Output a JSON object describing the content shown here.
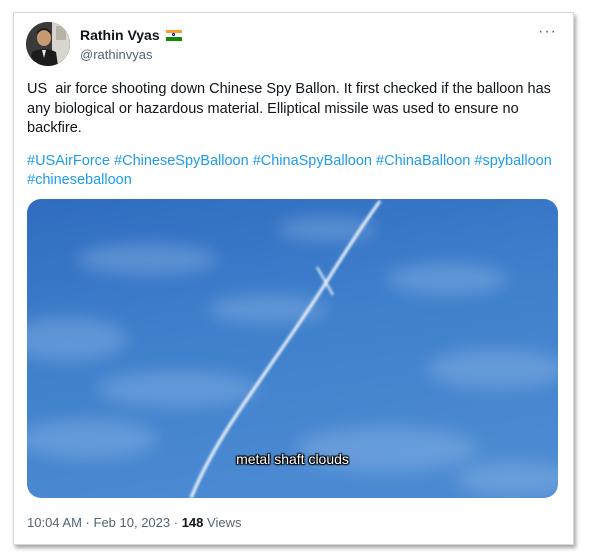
{
  "author": {
    "display_name": "Rathin Vyas",
    "handle": "@rathinvyas",
    "badge": "india-flag-icon"
  },
  "more_menu": {
    "icon": "more-horizontal-icon",
    "label": "···"
  },
  "tweet": {
    "text": "US  air force shooting down Chinese Spy Ballon. It first checked if the balloon has any biological or hazardous material. Elliptical missile was used to ensure no backfire.",
    "hashtags": [
      "#USAirForce",
      "#ChineseSpyBalloon",
      "#ChinaSpyBalloon",
      "#ChinaBalloon",
      "#spyballoon",
      "#chineseballoon"
    ]
  },
  "media": {
    "caption": "metal shaft clouds"
  },
  "meta": {
    "time": "10:04 AM",
    "separator": " · ",
    "date": "Feb 10, 2023",
    "views_count": "148",
    "views_label": "Views"
  },
  "colors": {
    "link": "#1d9bf0",
    "text": "#0f1419",
    "secondary": "#536471",
    "sky": "#3a78c4"
  }
}
